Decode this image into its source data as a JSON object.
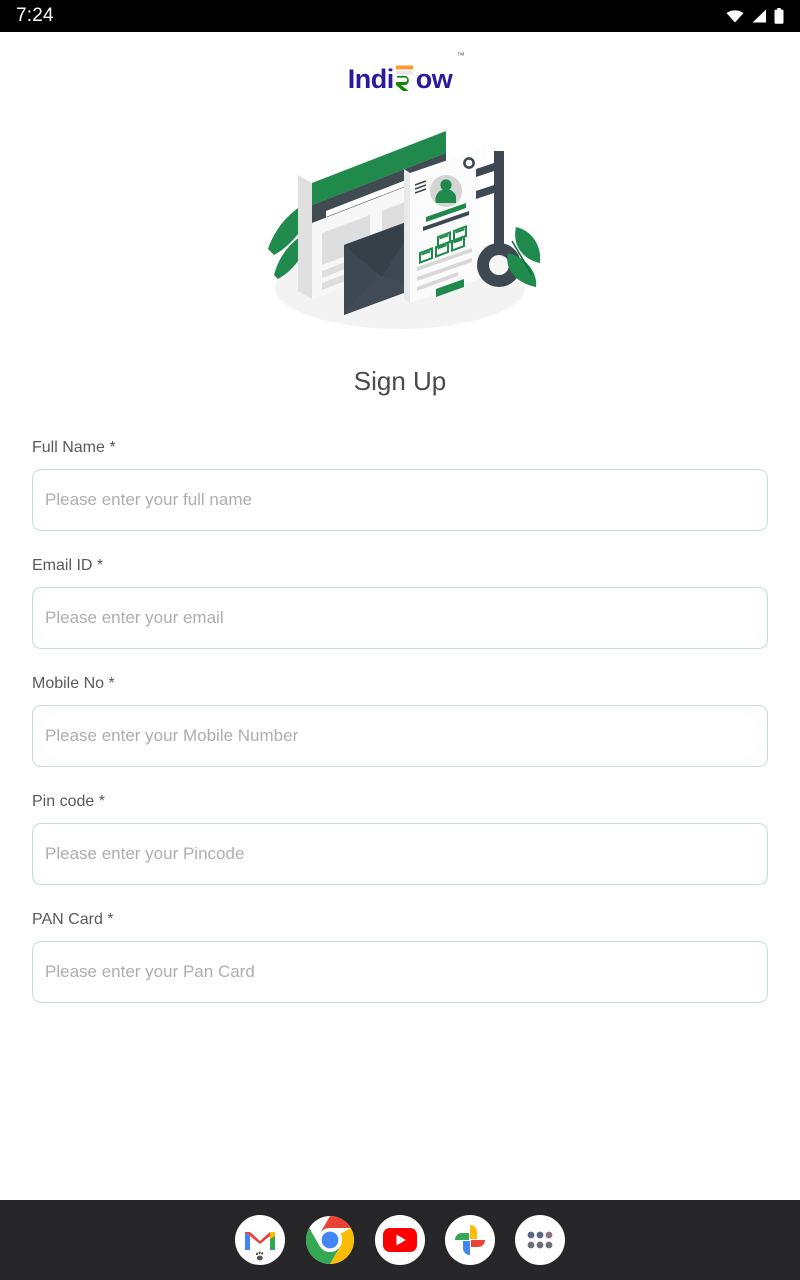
{
  "status_bar": {
    "time": "7:24",
    "icons": [
      "wifi-icon",
      "cellular-signal-icon",
      "battery-icon"
    ]
  },
  "brand": {
    "name_prefix": "Indi",
    "name_suffix": "ow",
    "rupee_glyph": "R",
    "trademark": "™",
    "color": "#2a1a9e",
    "accent_saffron": "#ff9933",
    "accent_green": "#138808"
  },
  "illustration": {
    "name": "signup-security-illustration",
    "elements": [
      "browser-window",
      "envelope",
      "profile-card",
      "key",
      "leaves",
      "ground-shadow"
    ],
    "colors": {
      "green": "#1f8a4c",
      "dark_slate": "#3d4852",
      "light_gray": "#e3e3e3",
      "shadow": "#f2f2f2"
    }
  },
  "page": {
    "title": "Sign Up"
  },
  "form": {
    "fields": [
      {
        "label": "Full Name *",
        "placeholder": "Please enter your full name",
        "name": "full-name"
      },
      {
        "label": "Email ID *",
        "placeholder": "Please enter your email",
        "name": "email-id"
      },
      {
        "label": "Mobile No *",
        "placeholder": "Please enter your Mobile Number",
        "name": "mobile-no"
      },
      {
        "label": "Pin code *",
        "placeholder": "Please enter your Pincode",
        "name": "pin-code"
      },
      {
        "label": "PAN Card *",
        "placeholder": "Please enter your Pan Card",
        "name": "pan-card"
      }
    ],
    "border_color": "#c5ded0",
    "label_color": "#5a5a5a",
    "placeholder_color": "#aeaeae"
  },
  "dock": {
    "background": "#262629",
    "items": [
      {
        "name": "gmail-icon",
        "label": "Gmail"
      },
      {
        "name": "chrome-icon",
        "label": "Chrome"
      },
      {
        "name": "youtube-icon",
        "label": "YouTube"
      },
      {
        "name": "google-photos-icon",
        "label": "Photos"
      },
      {
        "name": "app-drawer-icon",
        "label": "All apps"
      }
    ]
  }
}
